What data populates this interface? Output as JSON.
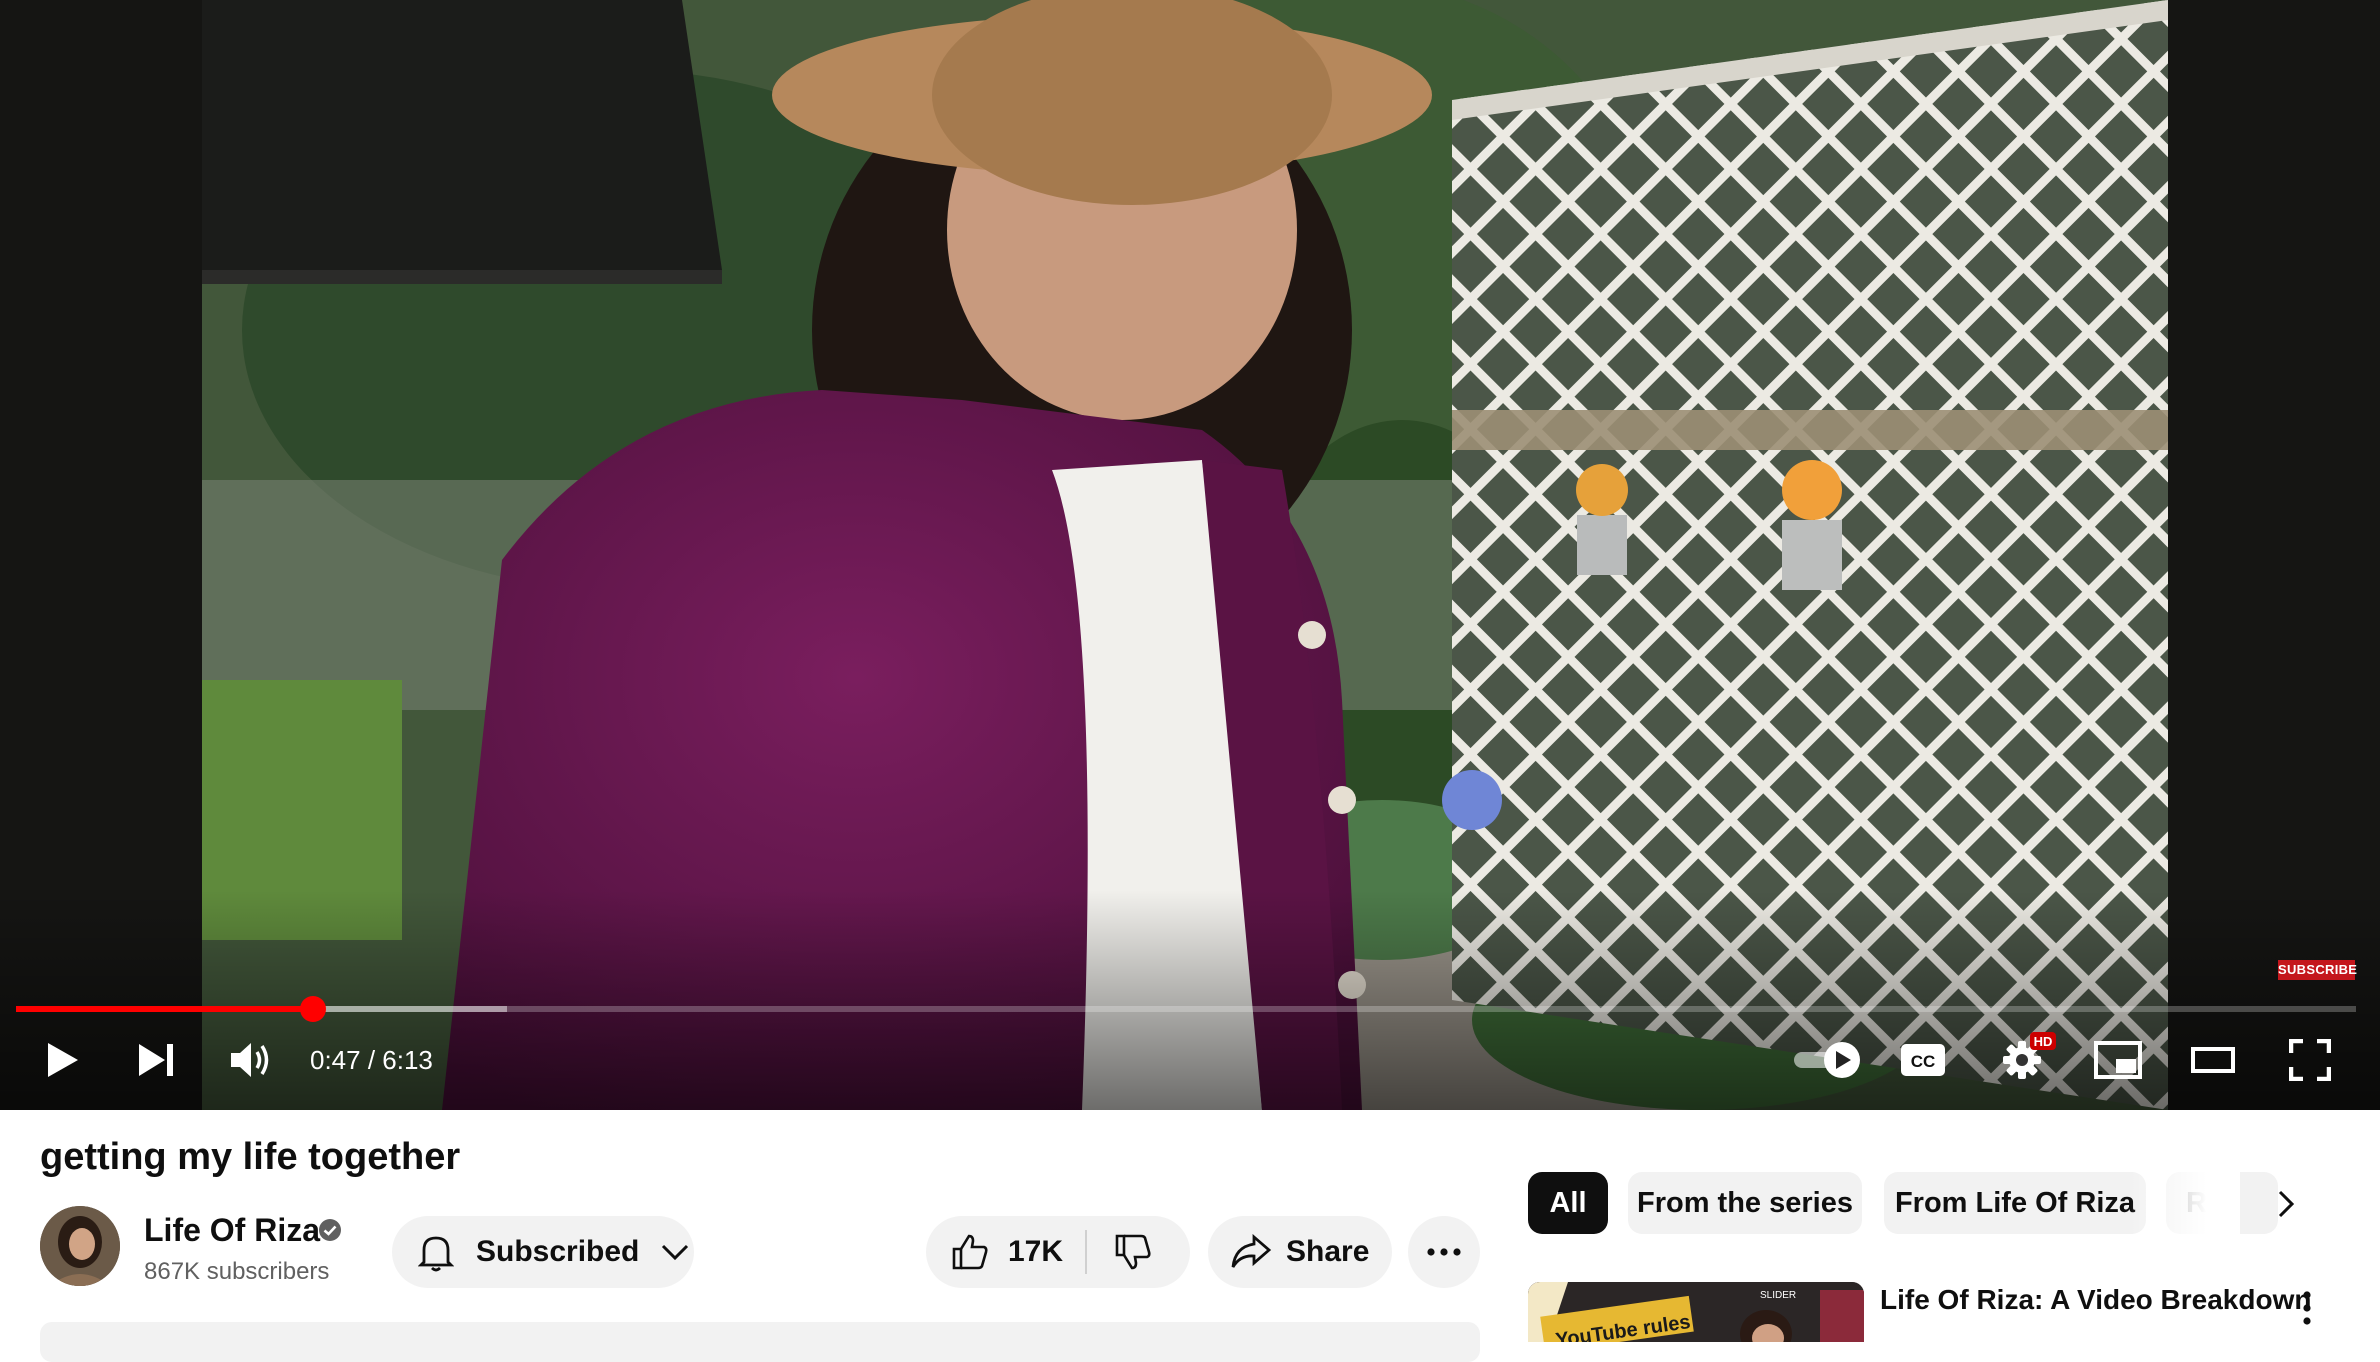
{
  "player": {
    "time_current": "0:47",
    "time_separator": " / ",
    "time_total": "6:13",
    "played_fraction": 0.127,
    "buffered_fraction": 0.21,
    "endscreen_subscribe": "SUBSCRIBE",
    "settings_badge": "HD",
    "cc_label": "CC",
    "autoplay": "on",
    "colors": {
      "progress": "#ff0000",
      "badge": "#c4161c"
    }
  },
  "video": {
    "title": "getting my life together"
  },
  "channel": {
    "name": "Life Of Riza",
    "verified": true,
    "subscribers": "867K subscribers",
    "subscribe_state": "Subscribed"
  },
  "actions": {
    "likes": "17K",
    "share": "Share"
  },
  "chips": [
    "All",
    "From the series",
    "From Life Of Riza",
    "Rel"
  ],
  "active_chip": "All",
  "recommended": [
    {
      "title": "Life Of Riza: A Video Breakdown",
      "thumbnail_text": "YouTube rules",
      "thumbnail_badge": "SLIDER"
    }
  ],
  "icons": {
    "play": "play-icon",
    "next": "next-icon",
    "volume": "volume-icon",
    "autoplay": "autoplay-toggle-icon",
    "captions": "cc-icon",
    "settings": "gear-icon",
    "miniplayer": "miniplayer-icon",
    "theater": "theater-icon",
    "fullscreen": "fullscreen-icon",
    "bell": "bell-icon",
    "chevron": "chevron-down-icon",
    "like": "thumbs-up-icon",
    "dislike": "thumbs-down-icon",
    "share": "share-icon",
    "more": "more-horizontal-icon",
    "chip_next": "chevron-right-icon",
    "rec_menu": "more-vertical-icon"
  }
}
